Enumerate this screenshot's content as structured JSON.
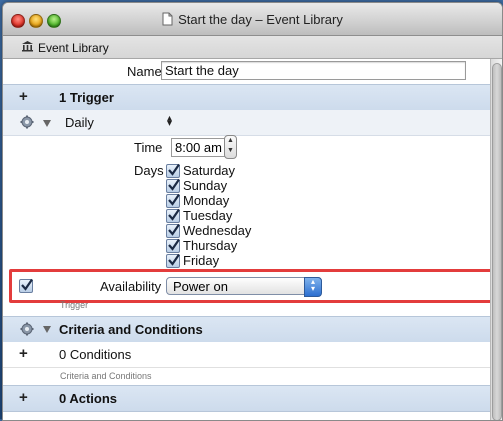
{
  "window": {
    "title": "Start the day – Event Library"
  },
  "toolbar": {
    "library_label": "Event Library"
  },
  "name_field": {
    "label": "Name",
    "value": "Start the day"
  },
  "trigger_section": {
    "toggle": "+",
    "title": "1 Trigger"
  },
  "trigger": {
    "type": "Daily",
    "time_label": "Time",
    "time_value": "8:00 am",
    "days_label": "Days",
    "days": [
      "Saturday",
      "Sunday",
      "Monday",
      "Tuesday",
      "Wednesday",
      "Thursday",
      "Friday"
    ],
    "availability_label": "Availability",
    "availability_value": "Power on",
    "caption": "Trigger"
  },
  "criteria_section": {
    "title": "Criteria and Conditions"
  },
  "conditions": {
    "toggle": "+",
    "label": "0 Conditions",
    "caption": "Criteria and Conditions"
  },
  "actions_section": {
    "toggle": "+",
    "title": "0 Actions"
  },
  "colors": {
    "highlight": "#e33c3c",
    "section_header": "#d3dfee"
  }
}
